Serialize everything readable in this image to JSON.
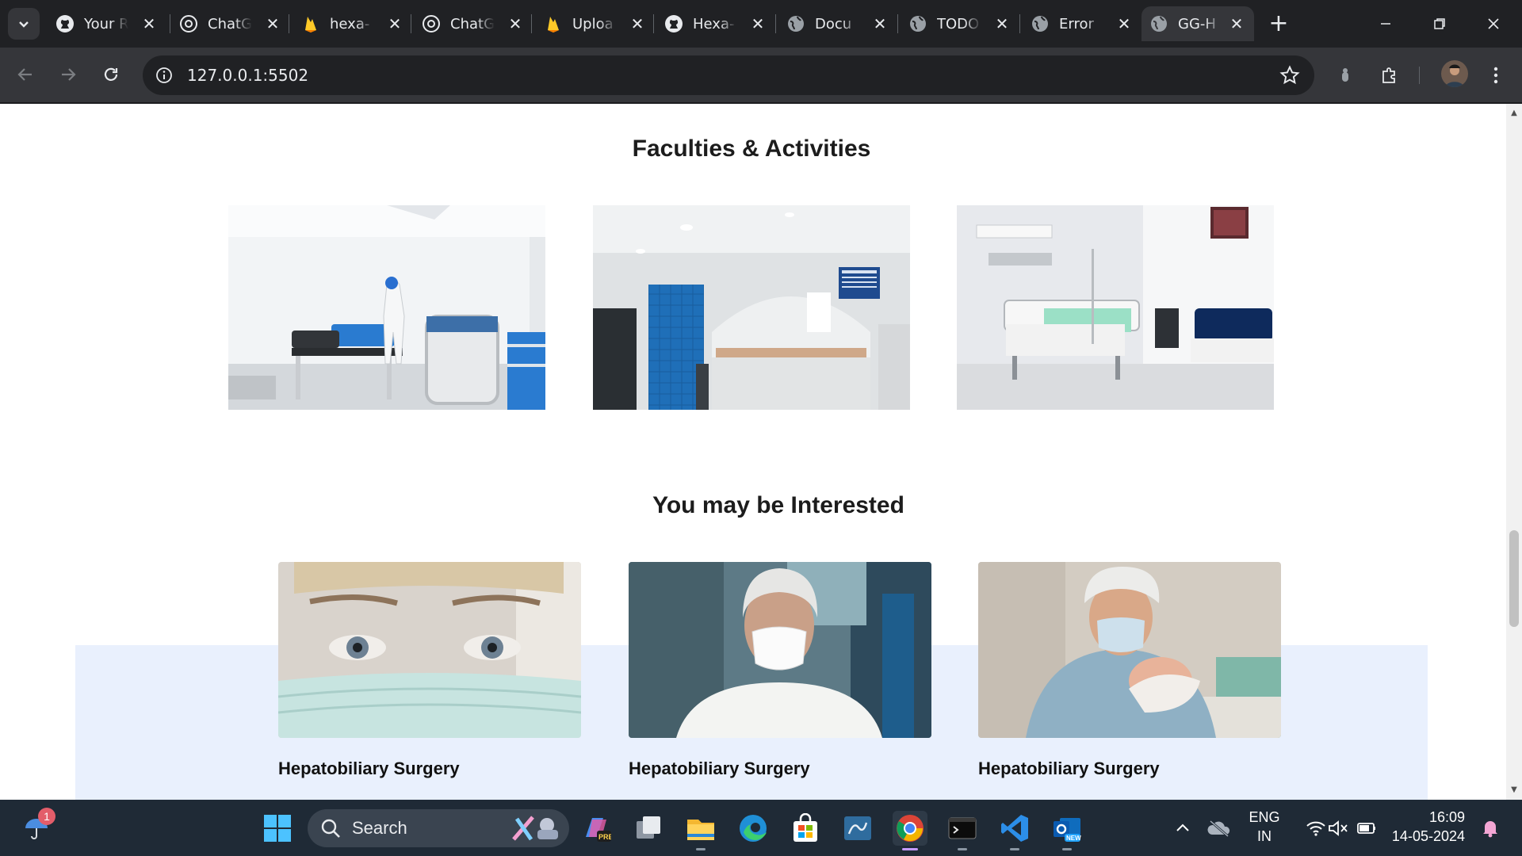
{
  "browser": {
    "tabs": [
      {
        "title": "Your R",
        "icon": "github-icon",
        "active": false
      },
      {
        "title": "ChatG",
        "icon": "openai-icon",
        "active": false
      },
      {
        "title": "hexa-",
        "icon": "firebase-icon",
        "active": false
      },
      {
        "title": "ChatG",
        "icon": "openai-icon",
        "active": false
      },
      {
        "title": "Uploa",
        "icon": "firebase-icon",
        "active": false
      },
      {
        "title": "Hexa-",
        "icon": "github-icon",
        "active": false
      },
      {
        "title": "Docu",
        "icon": "globe-icon",
        "active": false
      },
      {
        "title": "TODO",
        "icon": "globe-icon",
        "active": false
      },
      {
        "title": "Error",
        "icon": "globe-icon",
        "active": false
      },
      {
        "title": "GG-H",
        "icon": "globe-icon",
        "active": true
      }
    ],
    "url": "127.0.0.1:5502"
  },
  "page": {
    "faculties_title": "Faculties & Activities",
    "faculties_images": [
      "clinic-room-photo",
      "hospital-reception-photo",
      "hospital-ward-photo"
    ],
    "interested_title": "You may be Interested",
    "cards": [
      {
        "title": "Hepatobiliary Surgery",
        "image": "masked-nurse-photo"
      },
      {
        "title": "Hepatobiliary Surgery",
        "image": "masked-man-photo"
      },
      {
        "title": "Hepatobiliary Surgery",
        "image": "surgeon-newborn-photo"
      }
    ],
    "colors": {
      "band": "#e9f0fd",
      "heading": "#1c1c1c"
    }
  },
  "taskbar": {
    "search_label": "Search",
    "notification_count": "1",
    "language": "ENG",
    "region": "IN",
    "time": "16:09",
    "date": "14-05-2024"
  }
}
